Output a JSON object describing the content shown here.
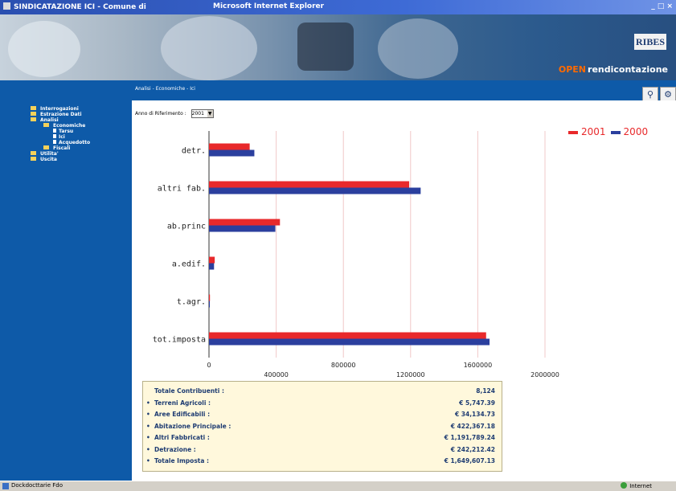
{
  "window": {
    "title": "SINDICATAZIONE ICI - Comune di",
    "app": "Microsoft Internet Explorer",
    "controls": "_ □ ×"
  },
  "banner": {
    "logo": "RIBES",
    "brand_open": "OPEN",
    "brand_rest": "rendicontazione"
  },
  "breadcrumb": "Analisi - Economiche - Ici",
  "toolbar": {
    "search_icon": "search-icon",
    "settings_icon": "gear-icon"
  },
  "sidebar": {
    "items": [
      {
        "label": "Interrogazioni",
        "level": 0,
        "type": "folder"
      },
      {
        "label": "Estrazione Dati",
        "level": 0,
        "type": "folder"
      },
      {
        "label": "Analisi",
        "level": 0,
        "type": "folder"
      },
      {
        "label": "Economiche",
        "level": 1,
        "type": "folder"
      },
      {
        "label": "Tarsu",
        "level": 2,
        "type": "doc"
      },
      {
        "label": "Ici",
        "level": 2,
        "type": "doc"
      },
      {
        "label": "Acquedotto",
        "level": 2,
        "type": "doc"
      },
      {
        "label": "Fiscali",
        "level": 1,
        "type": "folder"
      },
      {
        "label": "Utilita'",
        "level": 0,
        "type": "folder"
      },
      {
        "label": "Uscita",
        "level": 0,
        "type": "folder"
      }
    ]
  },
  "filter": {
    "label": "Anno di Riferimento :",
    "selected": "2001"
  },
  "chart_data": {
    "type": "bar",
    "orientation": "horizontal",
    "categories": [
      "detr.",
      "altri fab.",
      "ab.princ",
      "a.edif.",
      "t.agr.",
      "tot.imposta"
    ],
    "series": [
      {
        "name": "2001",
        "color": "#e8292b",
        "values": [
          242212,
          1191789,
          422367,
          34134,
          5747,
          1649607
        ]
      },
      {
        "name": "2000",
        "color": "#2b3f9e",
        "values": [
          270000,
          1260000,
          395000,
          30000,
          5000,
          1670000
        ]
      }
    ],
    "xlim": [
      0,
      2000000
    ],
    "xticks": [
      "0",
      "400000",
      "800000",
      "1200000",
      "1600000",
      "2000000"
    ],
    "legend_placement": "top-right",
    "grid": true
  },
  "summary": {
    "rows": [
      {
        "bullet": "",
        "label": "Totale Contribuenti :",
        "value": "8,124"
      },
      {
        "bullet": "•",
        "label": "Terreni Agricoli :",
        "value": "€ 5,747.39"
      },
      {
        "bullet": "•",
        "label": "Aree Edificabili :",
        "value": "€ 34,134.73"
      },
      {
        "bullet": "•",
        "label": "Abitazione Principale :",
        "value": "€ 422,367.18"
      },
      {
        "bullet": "•",
        "label": "Altri Fabbricati :",
        "value": "€ 1,191,789.24"
      },
      {
        "bullet": "•",
        "label": "Detrazione :",
        "value": "€ 242,212.42"
      },
      {
        "bullet": "•",
        "label": "Totale Imposta :",
        "value": "€ 1,649,607.13"
      }
    ]
  },
  "statusbar": {
    "text": "Dockdocttarie Fdo",
    "zone": "Internet"
  }
}
